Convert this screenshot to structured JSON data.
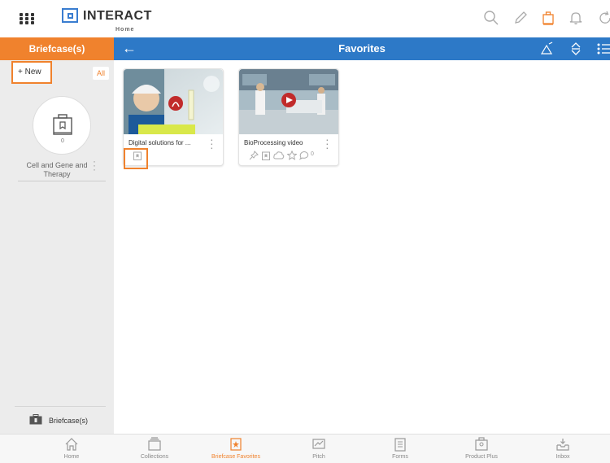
{
  "header": {
    "logo_text": "INTERACT",
    "logo_sub": "Home",
    "icons": [
      "search-icon",
      "pencil-icon",
      "briefcase-icon",
      "bell-icon",
      "refresh-icon"
    ]
  },
  "sidebar": {
    "title": "Briefcase(s)",
    "new_label": "+ New",
    "all_label": "All",
    "briefcase": {
      "count": "0",
      "label": "Cell and Gene and Therapy"
    },
    "footer_label": "Briefcase(s)"
  },
  "main": {
    "title": "Favorites",
    "cards": [
      {
        "title": "Digital solutions for ...",
        "badge_icon": "pdf-icon"
      },
      {
        "title": "BioProcessing video",
        "badge_icon": "play-icon",
        "comment_count": "0"
      }
    ]
  },
  "bottom_nav": [
    {
      "label": "Home",
      "icon": "home-icon"
    },
    {
      "label": "Collections",
      "icon": "collections-icon"
    },
    {
      "label": "Briefcase Favorites",
      "icon": "briefcase-favorites-icon",
      "active": true
    },
    {
      "label": "Pitch",
      "icon": "pitch-icon"
    },
    {
      "label": "Forms",
      "icon": "forms-icon"
    },
    {
      "label": "Product Plus",
      "icon": "product-plus-icon"
    },
    {
      "label": "Inbox",
      "icon": "inbox-icon"
    }
  ],
  "colors": {
    "accent": "#f0822d",
    "brand_blue": "#2d79c7",
    "sidebar_bg": "#ececec"
  }
}
